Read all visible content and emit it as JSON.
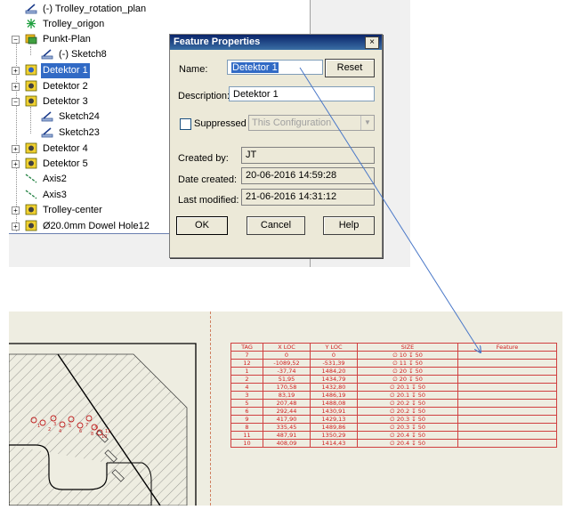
{
  "tree": {
    "items": [
      {
        "label": "(-) Trolley_rotation_plan",
        "icon": "sketch-icon"
      },
      {
        "label": "Trolley_origon",
        "icon": "origin-icon"
      },
      {
        "label": "Punkt-Plan",
        "icon": "folder-feature-icon"
      },
      {
        "label": "(-) Sketch8",
        "icon": "sketch-icon"
      },
      {
        "label": "Detektor 1",
        "icon": "hole-feature-icon",
        "selected": true
      },
      {
        "label": "Detektor 2",
        "icon": "hole-feature-icon"
      },
      {
        "label": "Detektor 3",
        "icon": "hole-feature-icon"
      },
      {
        "label": "Sketch24",
        "icon": "sketch-icon"
      },
      {
        "label": "Sketch23",
        "icon": "sketch-icon"
      },
      {
        "label": "Detektor 4",
        "icon": "hole-feature-icon"
      },
      {
        "label": "Detektor 5",
        "icon": "hole-feature-icon"
      },
      {
        "label": "Axis2",
        "icon": "axis-icon"
      },
      {
        "label": "Axis3",
        "icon": "axis-icon"
      },
      {
        "label": "Trolley-center",
        "icon": "hole-feature-icon"
      },
      {
        "label": "Ø20.0mm Dowel Hole12",
        "icon": "hole-feature-icon"
      }
    ]
  },
  "dialog": {
    "title": "Feature Properties",
    "close_label": "×",
    "name_label": "Name:",
    "name_value": "Detektor 1",
    "reset_label": "Reset",
    "description_label": "Description:",
    "description_value": "Detektor 1",
    "suppressed_label": "Suppressed",
    "configuration_value": "This Configuration",
    "created_by_label": "Created by:",
    "created_by_value": "JT",
    "date_created_label": "Date created:",
    "date_created_value": "20-06-2016 14:59:28",
    "last_modified_label": "Last modified:",
    "last_modified_value": "21-06-2016 14:31:12",
    "ok_label": "OK",
    "cancel_label": "Cancel",
    "help_label": "Help"
  },
  "hole_table": {
    "headers": [
      "TAG",
      "X LOC",
      "Y LOC",
      "SIZE",
      "Feature"
    ],
    "rows": [
      [
        "7",
        "0",
        "0",
        "∅ 10 ↧ 50",
        ""
      ],
      [
        "12",
        "-1089,52",
        "-531,39",
        "∅ 11 ↧ 50",
        ""
      ],
      [
        "1",
        "-37,74",
        "1484,20",
        "∅ 20 ↧ 50",
        ""
      ],
      [
        "2",
        "51,95",
        "1434,79",
        "∅ 20 ↧ 50",
        ""
      ],
      [
        "4",
        "170,58",
        "1432,80",
        "∅ 20.1 ↧ 50",
        ""
      ],
      [
        "3",
        "83,19",
        "1486,19",
        "∅ 20.1 ↧ 50",
        ""
      ],
      [
        "5",
        "207,48",
        "1488,08",
        "∅ 20.2 ↧ 50",
        ""
      ],
      [
        "6",
        "292,44",
        "1430,91",
        "∅ 20.2 ↧ 50",
        ""
      ],
      [
        "9",
        "417,90",
        "1429,13",
        "∅ 20.3 ↧ 50",
        ""
      ],
      [
        "8",
        "335,45",
        "1489,86",
        "∅ 20.3 ↧ 50",
        ""
      ],
      [
        "11",
        "487,91",
        "1350,29",
        "∅ 20.4 ↧ 50",
        ""
      ],
      [
        "10",
        "408,09",
        "1414,43",
        "∅ 20.4 ↧ 50",
        ""
      ]
    ]
  },
  "drawing": {
    "hole_tags": [
      "1",
      "2",
      "3",
      "4",
      "5",
      "6",
      "7",
      "8",
      "9",
      "10",
      "11"
    ]
  },
  "colors": {
    "selection": "#316ac5",
    "dialog_bg": "#ece9d8",
    "table_red": "#d02020",
    "arrow_blue": "#4a78c8",
    "drawing_bg": "#eeede1"
  }
}
